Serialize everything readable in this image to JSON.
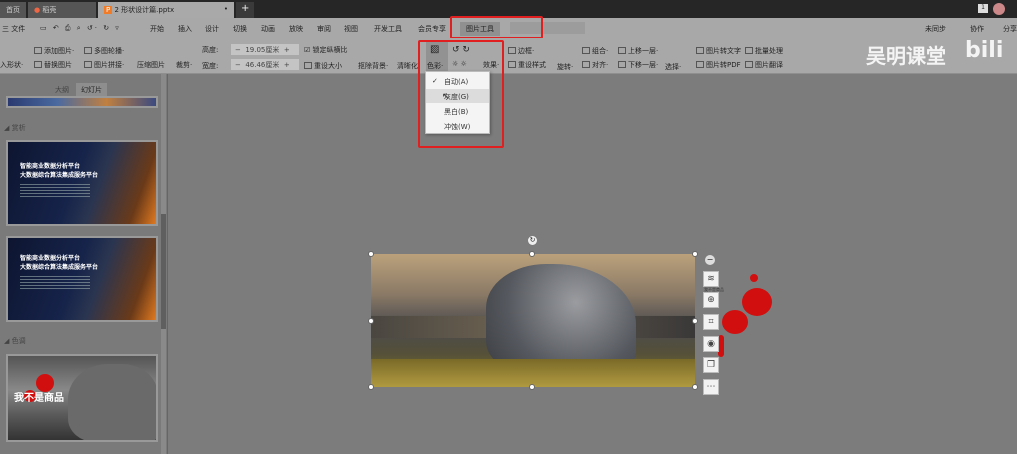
{
  "tabs": [
    {
      "label": "首页"
    },
    {
      "label": "稻壳"
    },
    {
      "label": "2 形状设计篇.pptx"
    }
  ],
  "tab_new": "+",
  "menubar": {
    "file": "三 文件",
    "items": [
      "开始",
      "插入",
      "设计",
      "切换",
      "动画",
      "放映",
      "审阅",
      "视图",
      "开发工具",
      "会员专享",
      "图片工具"
    ],
    "right": [
      "未同步",
      "协作",
      "分享"
    ]
  },
  "ribbon": {
    "insert_shape": "入形状·",
    "add_image": "添加图片·",
    "replace_image": "替换图片",
    "multi_carousel": "多图轮播·",
    "image_collage": "图片拼接·",
    "compress": "压缩图片",
    "crop": "裁剪·",
    "height_label": "高度:",
    "height_value": "19.05厘米",
    "width_label": "宽度:",
    "width_value": "46.46厘米",
    "lock_ratio": "锁定纵横比",
    "reset_size": "重设大小",
    "remove_bg": "抠除背景·",
    "clarify": "清晰化",
    "color": "色彩·",
    "effects": "效果·",
    "border": "边框·",
    "reset_style": "重设样式",
    "rotate": "旋转·",
    "group": "组合·",
    "align": "对齐·",
    "bring_forward": "上移一层·",
    "send_backward": "下移一层·",
    "select": "选择·",
    "img_to_text": "图片转文字",
    "batch": "批量处理",
    "img_to_pdf": "图片转PDF",
    "translate": "图片翻译"
  },
  "watermark": "吴明课堂",
  "watermark_logo": "bilibili",
  "color_menu": {
    "items": [
      {
        "label": "自动(A)",
        "checked": true
      },
      {
        "label": "灰度(G)",
        "hover": true
      },
      {
        "label": "黑白(B)"
      },
      {
        "label": "冲蚀(W)"
      }
    ]
  },
  "left_panel": {
    "tabs": [
      "大纲",
      "幻灯片"
    ],
    "sections": [
      "赏析",
      "色调"
    ],
    "slides": [
      {
        "title": "智能商业数据分析平台\n大数据综合算法集成服务平台"
      },
      {
        "title": "智能商业数据分析平台\n大数据综合算法集成服务平台"
      },
      {
        "title": "我不是商品"
      }
    ]
  },
  "float_toolbar": {
    "tooltip": "我不是商品"
  },
  "colors": {
    "highlight": "#e02020",
    "accent_tab": "#f07c2a"
  }
}
